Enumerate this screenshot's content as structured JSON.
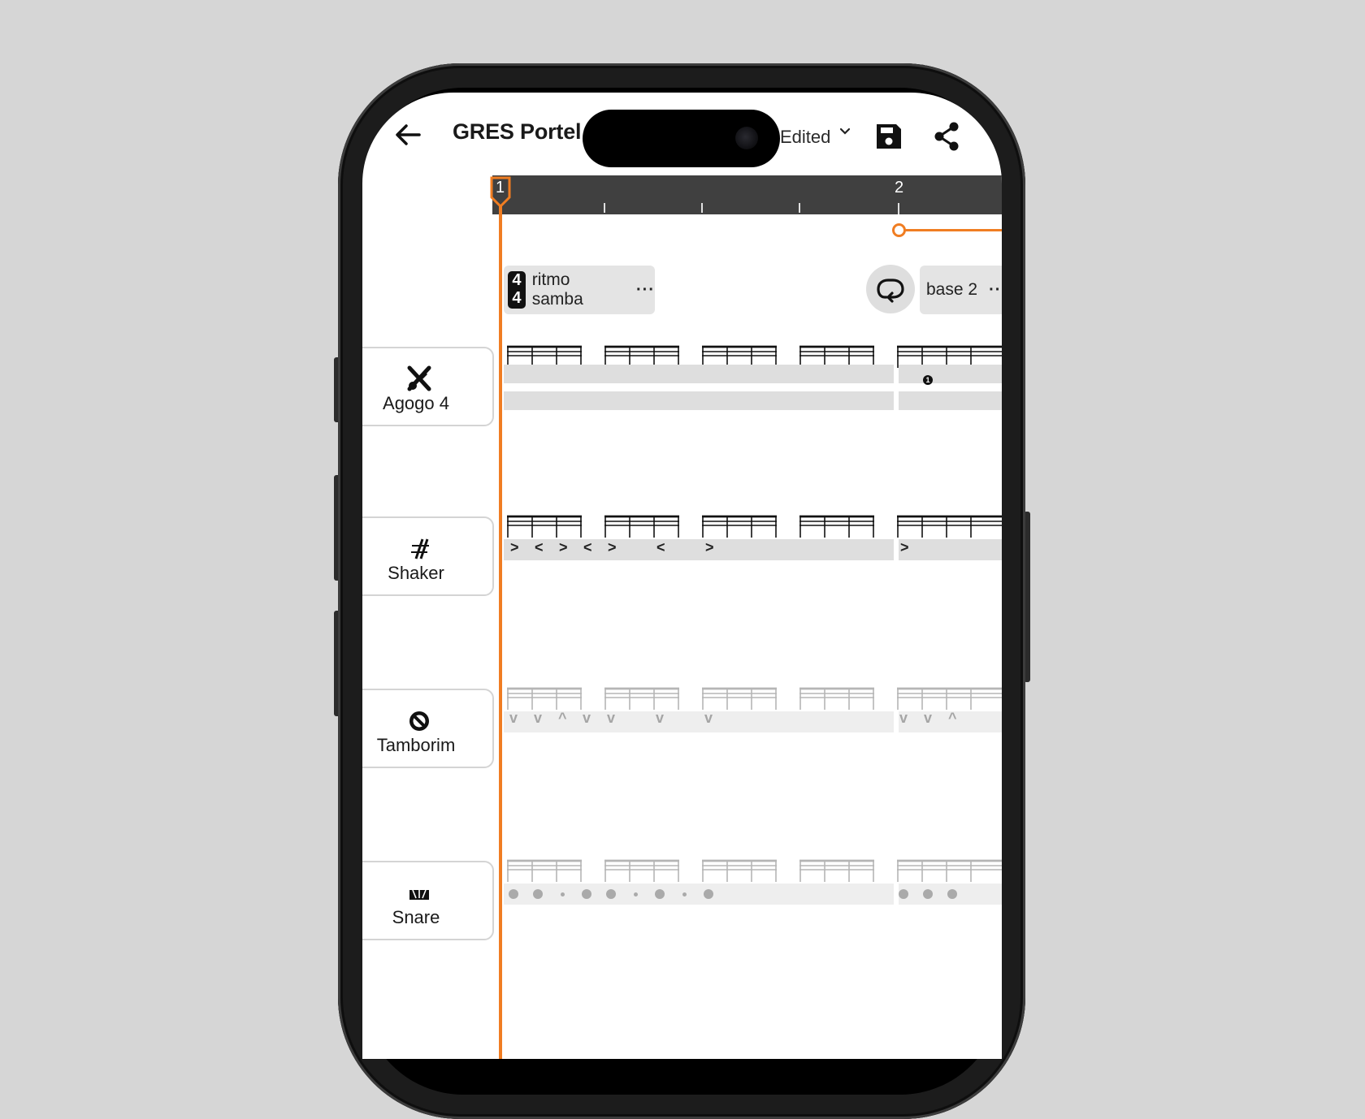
{
  "header": {
    "title": "GRES Portel",
    "status": "Edited",
    "icons": [
      "back-arrow-icon",
      "chevron-down-icon",
      "save-icon",
      "share-icon"
    ]
  },
  "ruler": {
    "measure_1": "1",
    "measure_2": "2"
  },
  "sections": [
    {
      "time_signature_top": "4",
      "time_signature_bottom": "4",
      "name": "ritmo samba",
      "more": "···"
    },
    {
      "name": "base 2",
      "more": "··"
    }
  ],
  "instruments": [
    {
      "name": "Agogo 4",
      "icon": "agogo-icon",
      "marks": [
        "1"
      ]
    },
    {
      "name": "Shaker",
      "icon": "shaker-icon",
      "marks": [
        ">",
        "<",
        ">",
        "<",
        ">",
        "<",
        ">",
        ">"
      ]
    },
    {
      "name": "Tamborim",
      "icon": "tamborim-icon",
      "marks": [
        "v",
        "v",
        "^",
        "v",
        "v",
        "v",
        "v",
        "v",
        "v",
        "^"
      ]
    },
    {
      "name": "Snare",
      "icon": "snare-icon"
    }
  ],
  "colors": {
    "accent": "#f07d22",
    "ruler": "#404040",
    "track": "#dedede"
  }
}
